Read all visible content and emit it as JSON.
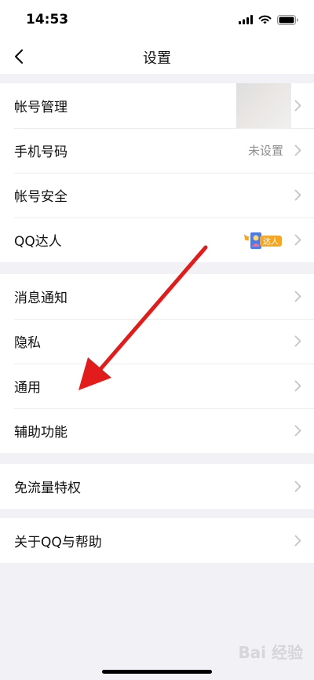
{
  "status_bar": {
    "time": "14:53"
  },
  "nav": {
    "title": "设置"
  },
  "groups": [
    {
      "rows": [
        {
          "label": "帐号管理"
        },
        {
          "label": "手机号码",
          "value": "未设置"
        },
        {
          "label": "帐号安全"
        },
        {
          "label": "QQ达人",
          "badge_text": "达人"
        }
      ]
    },
    {
      "rows": [
        {
          "label": "消息通知"
        },
        {
          "label": "隐私"
        },
        {
          "label": "通用"
        },
        {
          "label": "辅助功能"
        }
      ]
    },
    {
      "rows": [
        {
          "label": "免流量特权"
        }
      ]
    },
    {
      "rows": [
        {
          "label": "关于QQ与帮助"
        }
      ]
    }
  ],
  "watermark": {
    "text": "Bai 经验"
  },
  "colors": {
    "arrow": "#e21b1b",
    "badge": "#f5a623",
    "chevron": "#c4c4c8"
  }
}
